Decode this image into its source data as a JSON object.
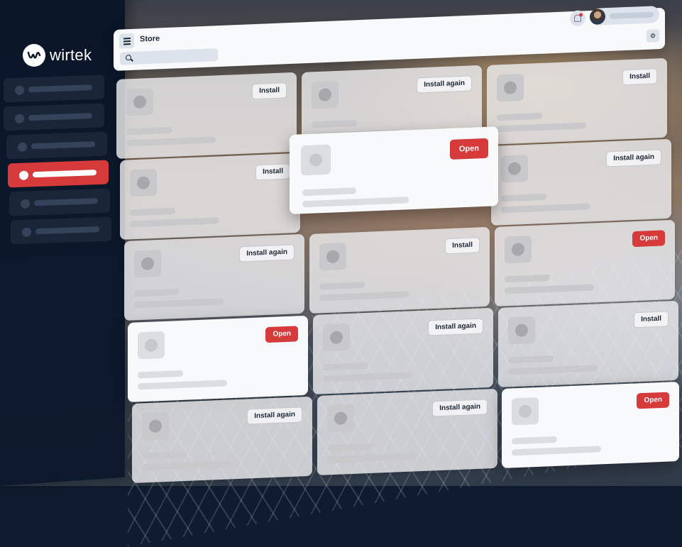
{
  "app": {
    "brand": "wirtek",
    "page_title": "Store"
  },
  "sidebar": {
    "items": [
      {
        "active": false
      },
      {
        "active": false
      },
      {
        "active": false
      },
      {
        "active": true
      },
      {
        "active": false
      },
      {
        "active": false
      }
    ]
  },
  "header": {
    "menu_icon": "hamburger-icon",
    "search_icon": "search-icon",
    "notification_icon": "bell-icon",
    "settings_icon": "gear-icon"
  },
  "cards": [
    {
      "action": "Install"
    },
    {
      "action": "Install again"
    },
    {
      "action": "Install"
    },
    {
      "action": "Install"
    },
    {
      "action": "Open"
    },
    {
      "action": "Install again"
    },
    {
      "action": "Install again"
    },
    {
      "action": "Install"
    },
    {
      "action": "Open"
    },
    {
      "action": "Open"
    },
    {
      "action": "Install again"
    },
    {
      "action": "Install"
    },
    {
      "action": "Install again"
    },
    {
      "action": "Install again"
    },
    {
      "action": "Open"
    }
  ],
  "colors": {
    "accent": "#d73a3a",
    "sidebar": "#0a1628",
    "surface": "#f8f9fb"
  }
}
